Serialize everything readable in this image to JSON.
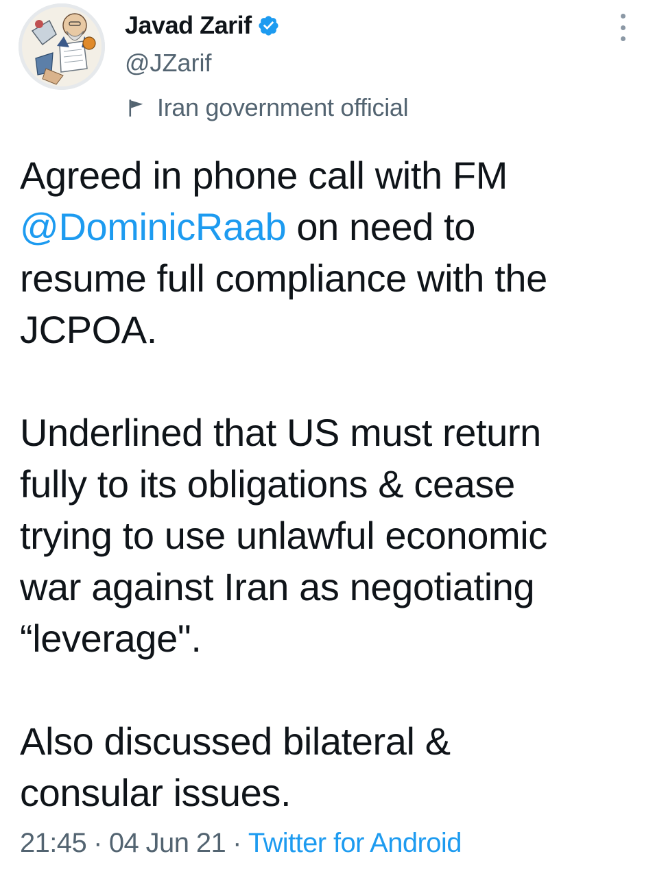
{
  "header": {
    "display_name": "Javad Zarif",
    "handle": "@JZarif",
    "account_label": "Iran government official",
    "verified_icon": "verified-badge-icon",
    "label_icon": "flag-icon",
    "more_icon": "more-vertical-icon"
  },
  "tweet": {
    "line1_a": "Agreed in phone call with FM",
    "mention": "@DominicRaab",
    "line2_b": " on need to",
    "line3": "resume full compliance with the",
    "line4": "JCPOA.",
    "p2_line1": "Underlined that US must return",
    "p2_line2": "fully to its obligations & cease",
    "p2_line3": "trying to use unlawful economic",
    "p2_line4": "war against Iran as negotiating",
    "p2_line5": "“leverage\".",
    "p3_line1": "Also discussed bilateral &",
    "p3_line2": "consular issues."
  },
  "meta": {
    "time": "21:45",
    "separator": "·",
    "date": "04 Jun 21",
    "source": "Twitter for Android"
  },
  "colors": {
    "link": "#1d9bf0",
    "text": "#0f1419",
    "secondary": "#536471"
  }
}
